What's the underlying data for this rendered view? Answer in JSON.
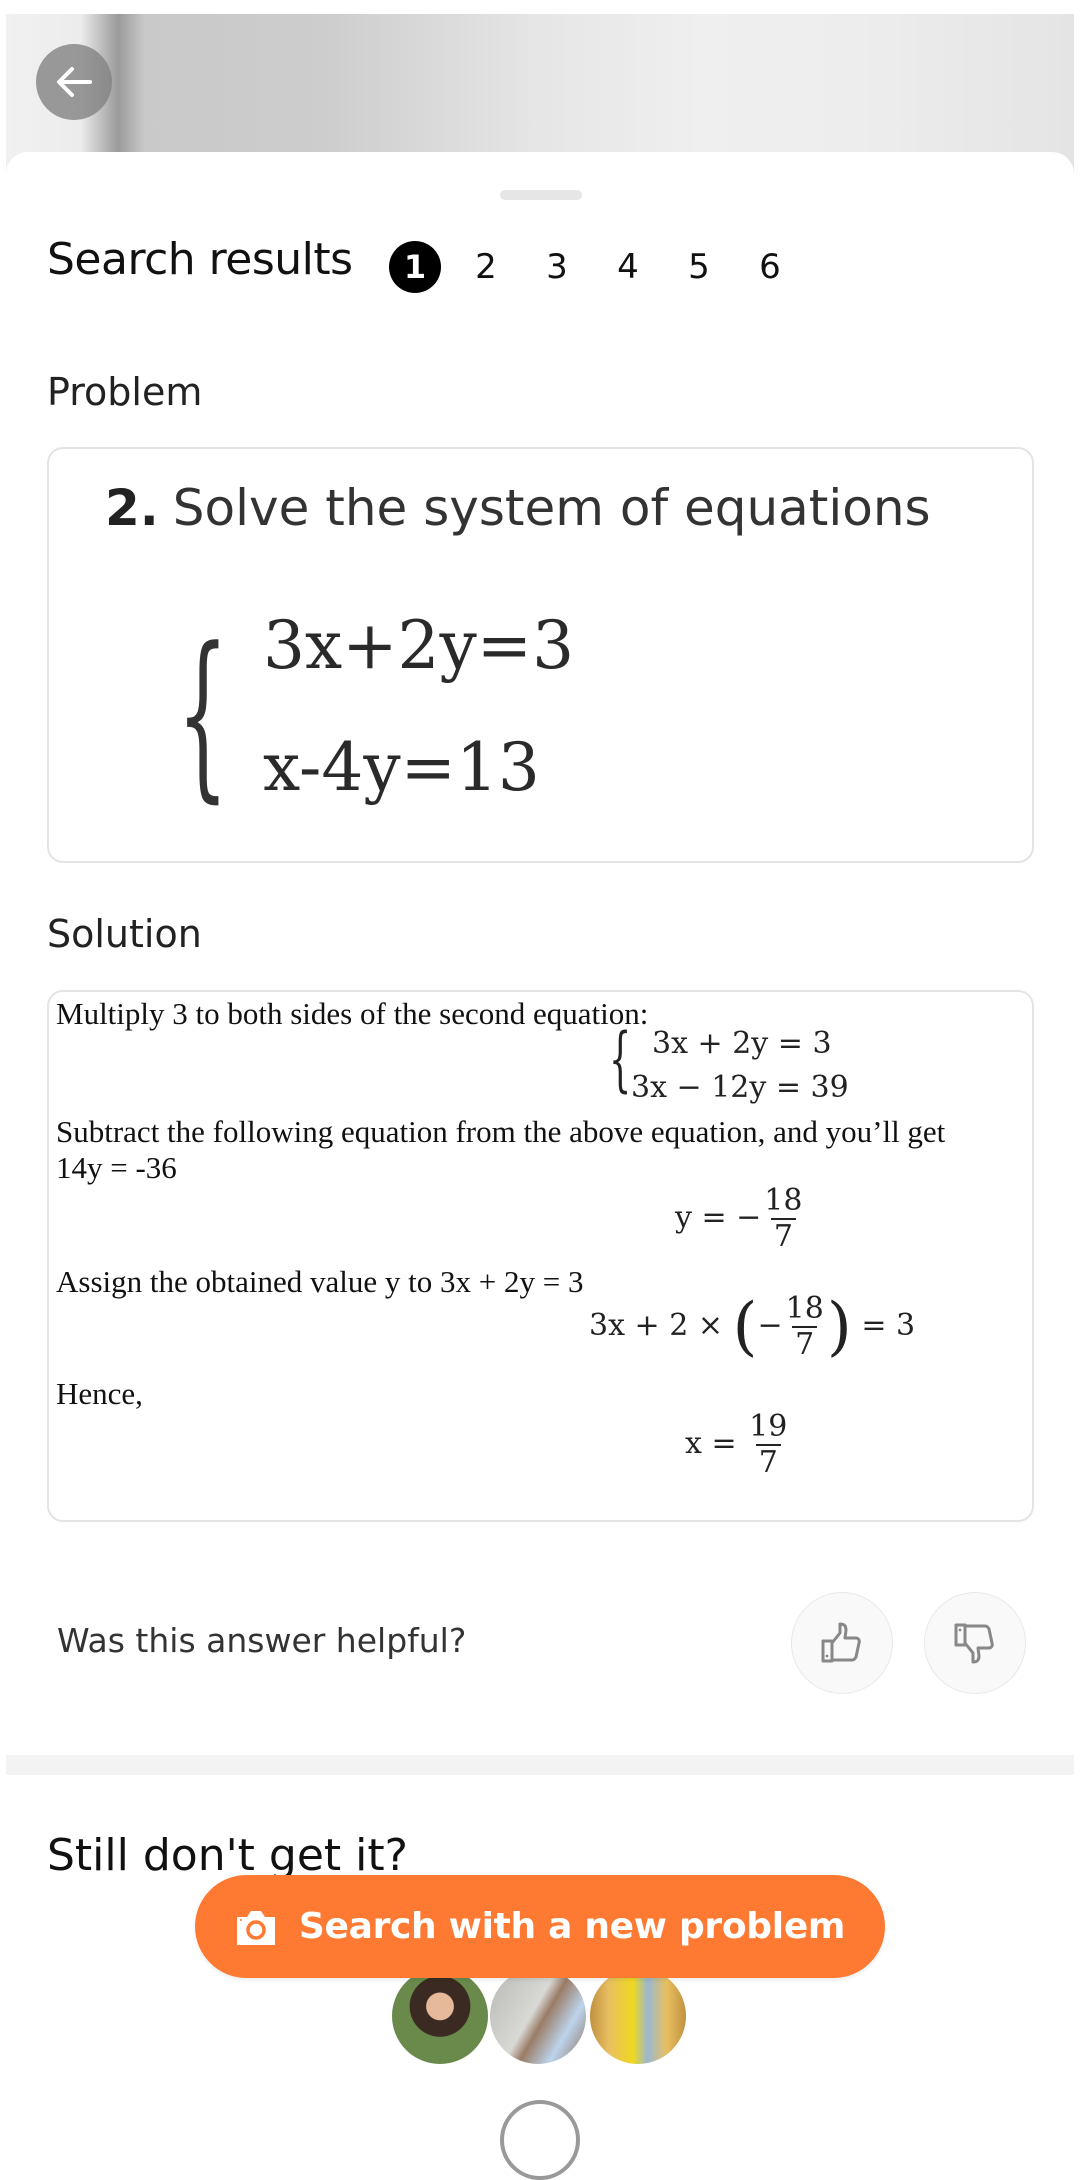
{
  "header": {
    "back_icon": "arrow-left-icon"
  },
  "search": {
    "title": "Search results",
    "pages": [
      "1",
      "2",
      "3",
      "4",
      "5",
      "6"
    ],
    "active_page": "1"
  },
  "problem": {
    "label": "Problem",
    "number": "2.",
    "statement": "Solve the system of equations",
    "equations": [
      "3x+2y=3",
      "x-4y=13"
    ]
  },
  "solution": {
    "label": "Solution",
    "step1": "Multiply 3 to both sides of the second equation:",
    "system": [
      "3x + 2y = 3",
      "3x − 12y = 39"
    ],
    "step2": "Subtract the following equation from the above equation, and you’ll get",
    "step2_result": "14y = -36",
    "y_lhs": "y = −",
    "y_num": "18",
    "y_den": "7",
    "step3": "Assign the obtained value y to 3x + 2y = 3",
    "sub_lhs": "3x + 2 × ",
    "sub_sign": "−",
    "sub_num": "18",
    "sub_den": "7",
    "sub_rhs": " = 3",
    "step4": "Hence,",
    "x_lhs": "x = ",
    "x_num": "19",
    "x_den": "7"
  },
  "feedback": {
    "question": "Was this answer helpful?",
    "like_icon": "thumbs-up-icon",
    "dislike_icon": "thumbs-down-icon"
  },
  "more_help": {
    "title": "Still don't get it?",
    "cta_label": "Search with a new problem",
    "cta_icon": "camera-icon",
    "cta_color": "#FE7A33",
    "avatars": [
      "tutor-avatar-1",
      "tutor-avatar-2",
      "tutor-avatar-3"
    ]
  }
}
